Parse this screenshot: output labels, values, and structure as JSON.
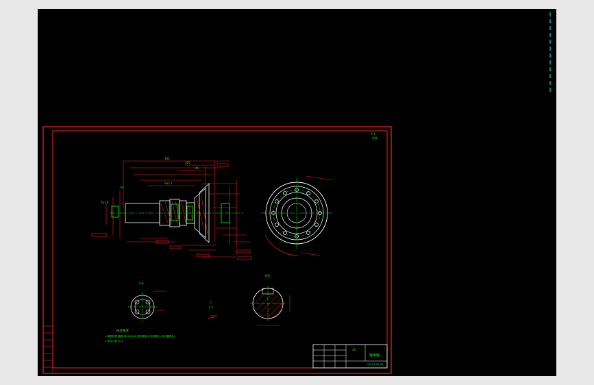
{
  "viewer": {
    "background": "#000000",
    "frame_color": "#e8e8e8"
  },
  "colors": {
    "border": "#ff2020",
    "dimension": "#ff2020",
    "annotation": "#00ff00",
    "geometry": "#ffffff",
    "accent": "#00ffff"
  },
  "labels": {
    "top_right_a": "5:1",
    "top_right_b": "比例",
    "dim_total": "185",
    "dim_a": "105",
    "dim_b": "45",
    "dim_c": "30",
    "section_a_label": "A-A",
    "section_b_label": "B-B",
    "section_c_label": "C",
    "section_c_sub": "C-1",
    "detail_label": "1",
    "tech_title": "技术要求",
    "tech_line1": "1.调质处理,硬度HB220-250,锐边倒钝,未注倒角C1,未注圆角R1",
    "tech_line2": "2.未注公差 IT12",
    "title_block_name": "输出轴",
    "title_block_code": "LYTJ-07-00-00",
    "title_block_material": "45",
    "ra_a": "Ra1.6",
    "ra_b": "Ra3.2"
  }
}
